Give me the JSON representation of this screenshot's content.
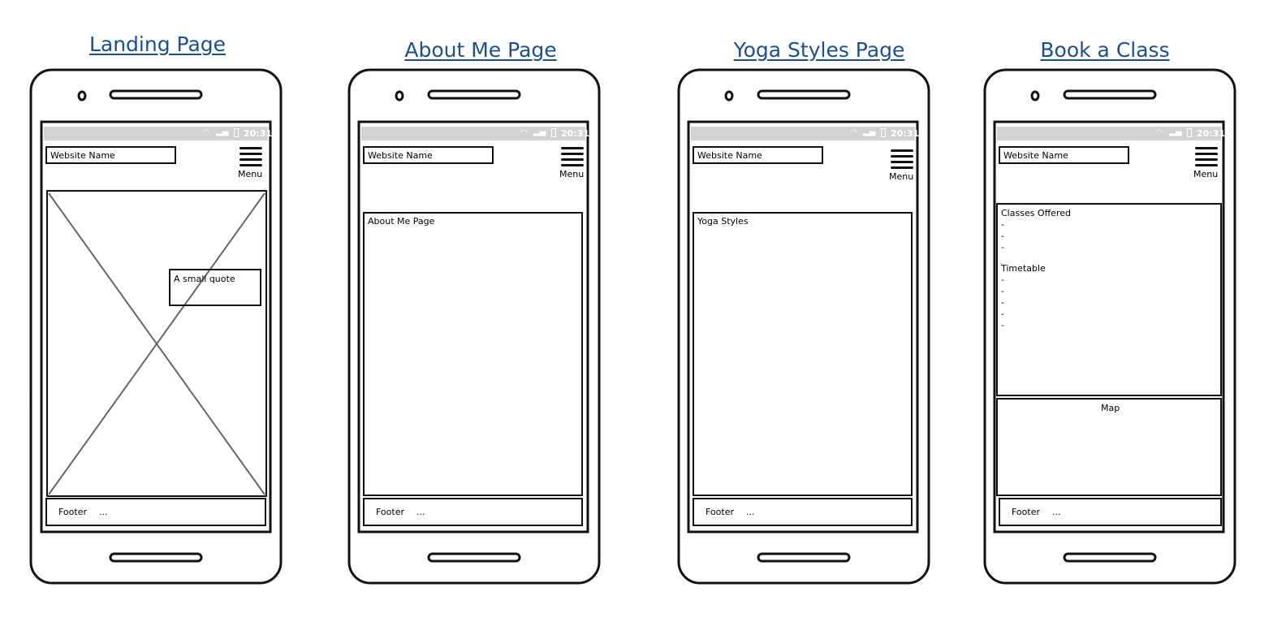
{
  "pages": [
    {
      "title": "Landing Page",
      "status_time": "20:31",
      "site_name": "Website Name",
      "menu_label": "Menu",
      "quote": "A small quote",
      "footer_label": "Footer",
      "footer_dots": "..."
    },
    {
      "title": "About Me Page",
      "status_time": "20:31",
      "site_name": "Website Name",
      "menu_label": "Menu",
      "content_label": "About Me Page",
      "footer_label": "Footer",
      "footer_dots": "..."
    },
    {
      "title": "Yoga Styles Page",
      "status_time": "20:31",
      "site_name": "Website Name",
      "menu_label": "Menu",
      "content_label": "Yoga Styles",
      "footer_label": "Footer",
      "footer_dots": "..."
    },
    {
      "title": "Book a Class",
      "status_time": "20:31",
      "site_name": "Website Name",
      "menu_label": "Menu",
      "classes_heading": "Classes Offered",
      "classes_items": [
        "-",
        "-",
        "-"
      ],
      "timetable_heading": "Timetable",
      "timetable_items": [
        "-",
        "-",
        "-",
        "-",
        "-"
      ],
      "map_label": "Map",
      "footer_label": "Footer",
      "footer_dots": "..."
    }
  ],
  "colors": {
    "title": "#1c4f8c",
    "outline": "#111111",
    "statusbar": "#d2d2d2"
  }
}
